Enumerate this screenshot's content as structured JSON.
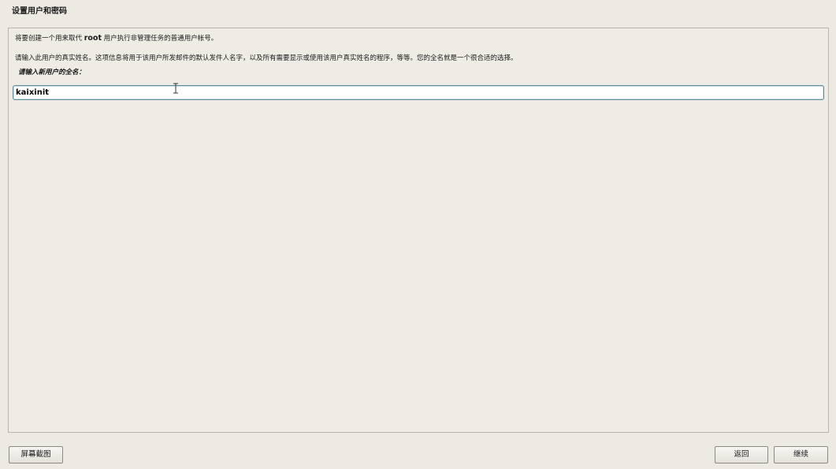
{
  "window": {
    "title": "设置用户和密码"
  },
  "panel": {
    "intro_prefix": "将要创建一个用来取代 ",
    "intro_root": "root",
    "intro_suffix": " 用户执行非管理任务的普通用户帐号。",
    "explanation": "请输入此用户的真实姓名。这项信息将用于该用户所发邮件的默认发件人名字，以及所有需要显示或使用该用户真实姓名的程序，等等。您的全名就是一个很合适的选择。",
    "prompt": "请输入新用户的全名："
  },
  "fullname_input": {
    "value": "kaixinit"
  },
  "buttons": {
    "screenshot": "屏幕截图",
    "back": "返回",
    "continue": "继续"
  },
  "icons": {
    "cursor": "text-cursor-ibeam-icon"
  }
}
